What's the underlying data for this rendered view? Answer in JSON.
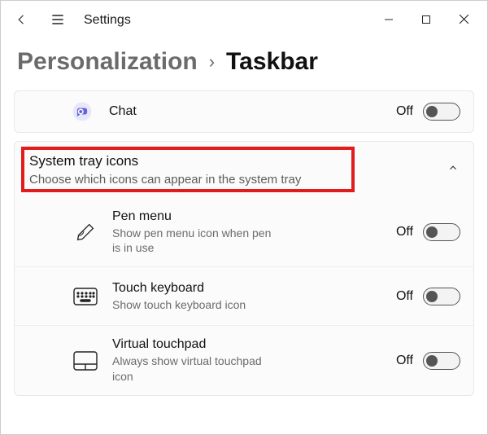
{
  "app": {
    "title": "Settings"
  },
  "breadcrumb": {
    "parent": "Personalization",
    "sep": "›",
    "current": "Taskbar"
  },
  "chat": {
    "title": "Chat",
    "state": "Off"
  },
  "group": {
    "title": "System tray icons",
    "subtitle": "Choose which icons can appear in the system tray"
  },
  "items": [
    {
      "title": "Pen menu",
      "sub": "Show pen menu icon when pen is in use",
      "state": "Off"
    },
    {
      "title": "Touch keyboard",
      "sub": "Show touch keyboard icon",
      "state": "Off"
    },
    {
      "title": "Virtual touchpad",
      "sub": "Always show virtual touchpad icon",
      "state": "Off"
    }
  ]
}
